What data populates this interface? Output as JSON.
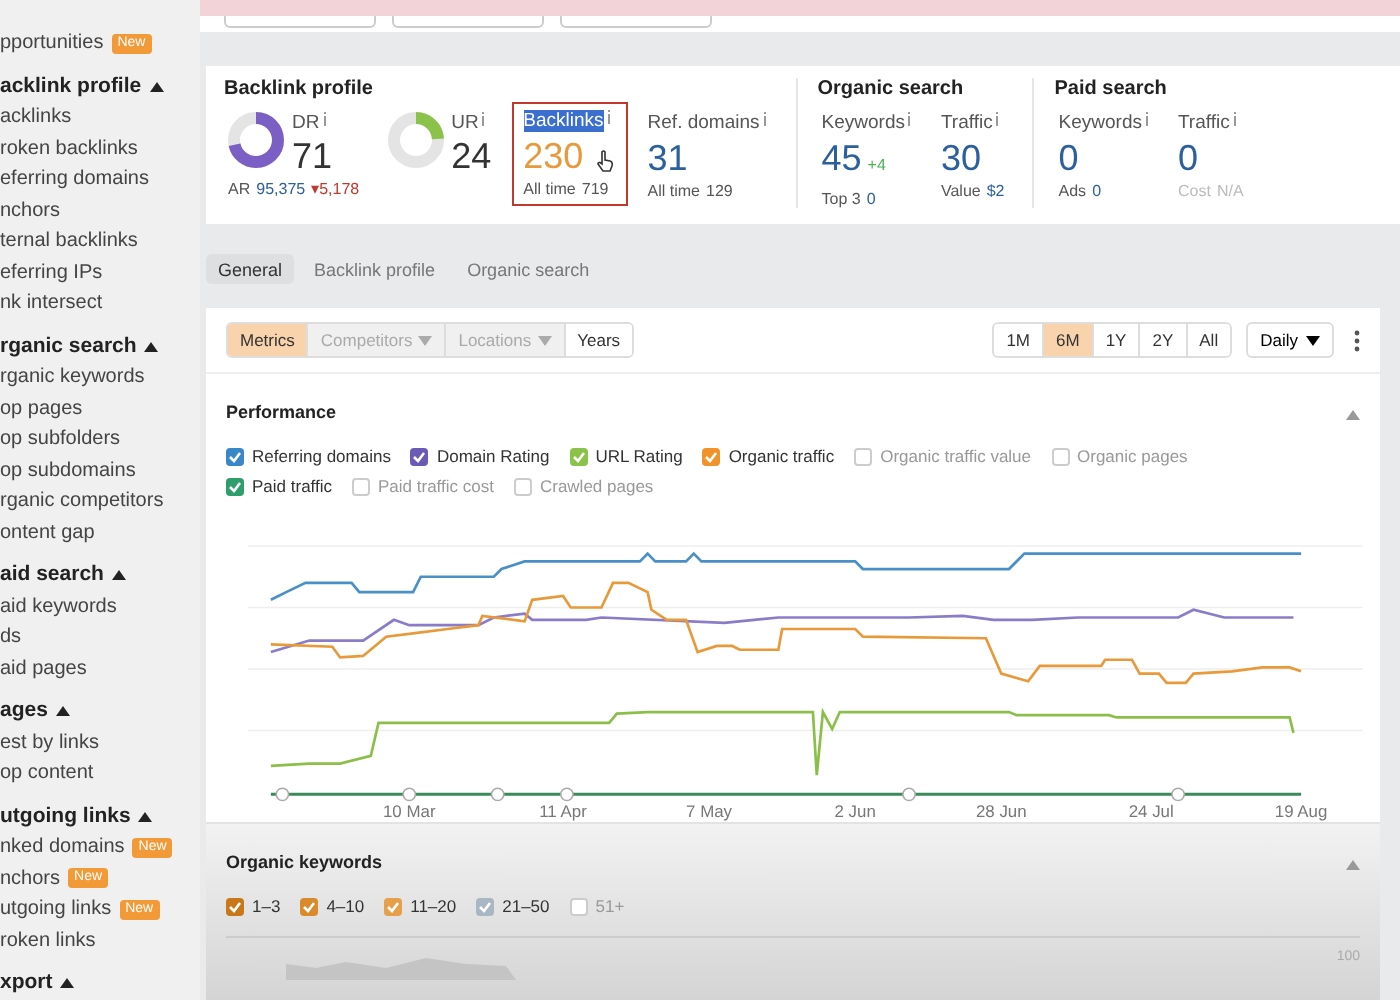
{
  "sidebar": {
    "items": [
      {
        "kind": "link",
        "label": "pportunities",
        "badge": "New"
      },
      {
        "kind": "heading",
        "label": "acklink profile",
        "expanded": true
      },
      {
        "kind": "link",
        "label": "acklinks"
      },
      {
        "kind": "link",
        "label": "roken backlinks"
      },
      {
        "kind": "link",
        "label": "eferring domains"
      },
      {
        "kind": "link",
        "label": "nchors"
      },
      {
        "kind": "link",
        "label": "ternal backlinks"
      },
      {
        "kind": "link",
        "label": "eferring IPs"
      },
      {
        "kind": "link",
        "label": "nk intersect"
      },
      {
        "kind": "heading",
        "label": "rganic search",
        "expanded": true
      },
      {
        "kind": "link",
        "label": "rganic keywords"
      },
      {
        "kind": "link",
        "label": "op pages"
      },
      {
        "kind": "link",
        "label": "op subfolders"
      },
      {
        "kind": "link",
        "label": "op subdomains"
      },
      {
        "kind": "link",
        "label": "rganic competitors"
      },
      {
        "kind": "link",
        "label": "ontent gap"
      },
      {
        "kind": "heading",
        "label": "aid search",
        "expanded": true
      },
      {
        "kind": "link",
        "label": "aid keywords"
      },
      {
        "kind": "link",
        "label": "ds"
      },
      {
        "kind": "link",
        "label": "aid pages"
      },
      {
        "kind": "heading",
        "label": "ages",
        "expanded": true
      },
      {
        "kind": "link",
        "label": "est by links"
      },
      {
        "kind": "link",
        "label": "op content"
      },
      {
        "kind": "heading",
        "label": "utgoing links",
        "expanded": true
      },
      {
        "kind": "link",
        "label": "nked domains",
        "badge": "New"
      },
      {
        "kind": "link",
        "label": "nchors",
        "badge": "New"
      },
      {
        "kind": "link",
        "label": "utgoing links",
        "badge": "New"
      },
      {
        "kind": "link",
        "label": "roken links"
      },
      {
        "kind": "heading",
        "label": "xport",
        "expanded": true
      }
    ]
  },
  "overview": {
    "sections": [
      {
        "title": "Backlink profile",
        "metrics": [
          {
            "kind": "donut",
            "label": "DR",
            "value": {
              "text": "71",
              "kind": "plain"
            },
            "level": 0.71,
            "color": "#7b5fc4",
            "footer": [
              {
                "text": "AR",
                "kind": "muted"
              },
              {
                "text": "95,375",
                "kind": "link"
              },
              {
                "text": "▾5,178",
                "kind": "down"
              }
            ]
          },
          {
            "kind": "donut",
            "label": "UR",
            "value": {
              "text": "24",
              "kind": "plain"
            },
            "level": 0.24,
            "color": "#8bc34a"
          },
          {
            "kind": "number",
            "label": "Backlinks",
            "value": {
              "text": "230",
              "kind": "accent"
            },
            "highlighted": true,
            "footer": [
              {
                "text": "All time",
                "kind": "muted"
              },
              {
                "text": "719",
                "kind": "muted"
              }
            ]
          },
          {
            "kind": "number",
            "label": "Ref. domains",
            "value": {
              "text": "31",
              "kind": "link"
            },
            "highlighted": false,
            "footer": [
              {
                "text": "All time",
                "kind": "muted"
              },
              {
                "text": "129",
                "kind": "muted"
              }
            ]
          }
        ]
      },
      {
        "title": "Organic search",
        "metrics": [
          {
            "kind": "number",
            "label": "Keywords",
            "value": {
              "text": "45",
              "kind": "link"
            },
            "delta": "+4",
            "highlighted": false,
            "footer": [
              {
                "text": "Top 3",
                "kind": "muted"
              },
              {
                "text": "0",
                "kind": "link"
              }
            ]
          },
          {
            "kind": "number",
            "label": "Traffic",
            "value": {
              "text": "30",
              "kind": "link"
            },
            "highlighted": false,
            "footer": [
              {
                "text": "Value",
                "kind": "muted"
              },
              {
                "text": "$2",
                "kind": "link"
              }
            ]
          }
        ]
      },
      {
        "title": "Paid search",
        "metrics": [
          {
            "kind": "number",
            "label": "Keywords",
            "value": {
              "text": "0",
              "kind": "link"
            },
            "highlighted": false,
            "footer": [
              {
                "text": "Ads",
                "kind": "muted"
              },
              {
                "text": "0",
                "kind": "link"
              }
            ]
          },
          {
            "kind": "number",
            "label": "Traffic",
            "value": {
              "text": "0",
              "kind": "link"
            },
            "highlighted": false,
            "footer": [
              {
                "text": "Cost",
                "kind": "disabled"
              },
              {
                "text": "N/A",
                "kind": "disabled"
              }
            ]
          }
        ]
      }
    ]
  },
  "tabs": [
    {
      "label": "General",
      "selected": true
    },
    {
      "label": "Backlink profile",
      "selected": false
    },
    {
      "label": "Organic search",
      "selected": false
    }
  ],
  "toolbar": {
    "modes": [
      {
        "label": "Metrics",
        "selected": true,
        "disabled": false,
        "dropdown": false
      },
      {
        "label": "Competitors",
        "selected": false,
        "disabled": true,
        "dropdown": true
      },
      {
        "label": "Locations",
        "selected": false,
        "disabled": true,
        "dropdown": true
      },
      {
        "label": "Years",
        "selected": false,
        "disabled": false,
        "dropdown": false
      }
    ],
    "ranges": [
      {
        "label": "1M",
        "selected": false
      },
      {
        "label": "6M",
        "selected": true
      },
      {
        "label": "1Y",
        "selected": false
      },
      {
        "label": "2Y",
        "selected": false
      },
      {
        "label": "All",
        "selected": false
      }
    ],
    "interval": "Daily"
  },
  "performance": {
    "title": "Performance",
    "expanded": true,
    "legend": [
      {
        "label": "Referring domains",
        "checked": true,
        "color": "#3a87c8"
      },
      {
        "label": "Domain Rating",
        "checked": true,
        "color": "#6b5bb5"
      },
      {
        "label": "URL Rating",
        "checked": true,
        "color": "#8bc34a"
      },
      {
        "label": "Organic traffic",
        "checked": true,
        "color": "#f0932b"
      },
      {
        "label": "Organic traffic value",
        "checked": false
      },
      {
        "label": "Organic pages",
        "checked": false
      },
      {
        "label": "Paid traffic",
        "checked": true,
        "color": "#2e9e6b"
      },
      {
        "label": "Paid traffic cost",
        "checked": false
      },
      {
        "label": "Crawled pages",
        "checked": false
      }
    ],
    "x_labels": [
      "10 Mar",
      "11 Apr",
      "7 May",
      "2 Jun",
      "28 Jun",
      "24 Jul",
      "19 Aug"
    ]
  },
  "organic_keywords": {
    "title": "Organic keywords",
    "expanded": true,
    "legend": [
      {
        "label": "1–3",
        "checked": true,
        "color": "#c8781a"
      },
      {
        "label": "4–10",
        "checked": true,
        "color": "#d98a2a"
      },
      {
        "label": "11–20",
        "checked": true,
        "color": "#e6a04c"
      },
      {
        "label": "21–50",
        "checked": true,
        "color": "#a9b6c4"
      },
      {
        "label": "51+",
        "checked": false
      }
    ],
    "y_label": "100"
  }
}
